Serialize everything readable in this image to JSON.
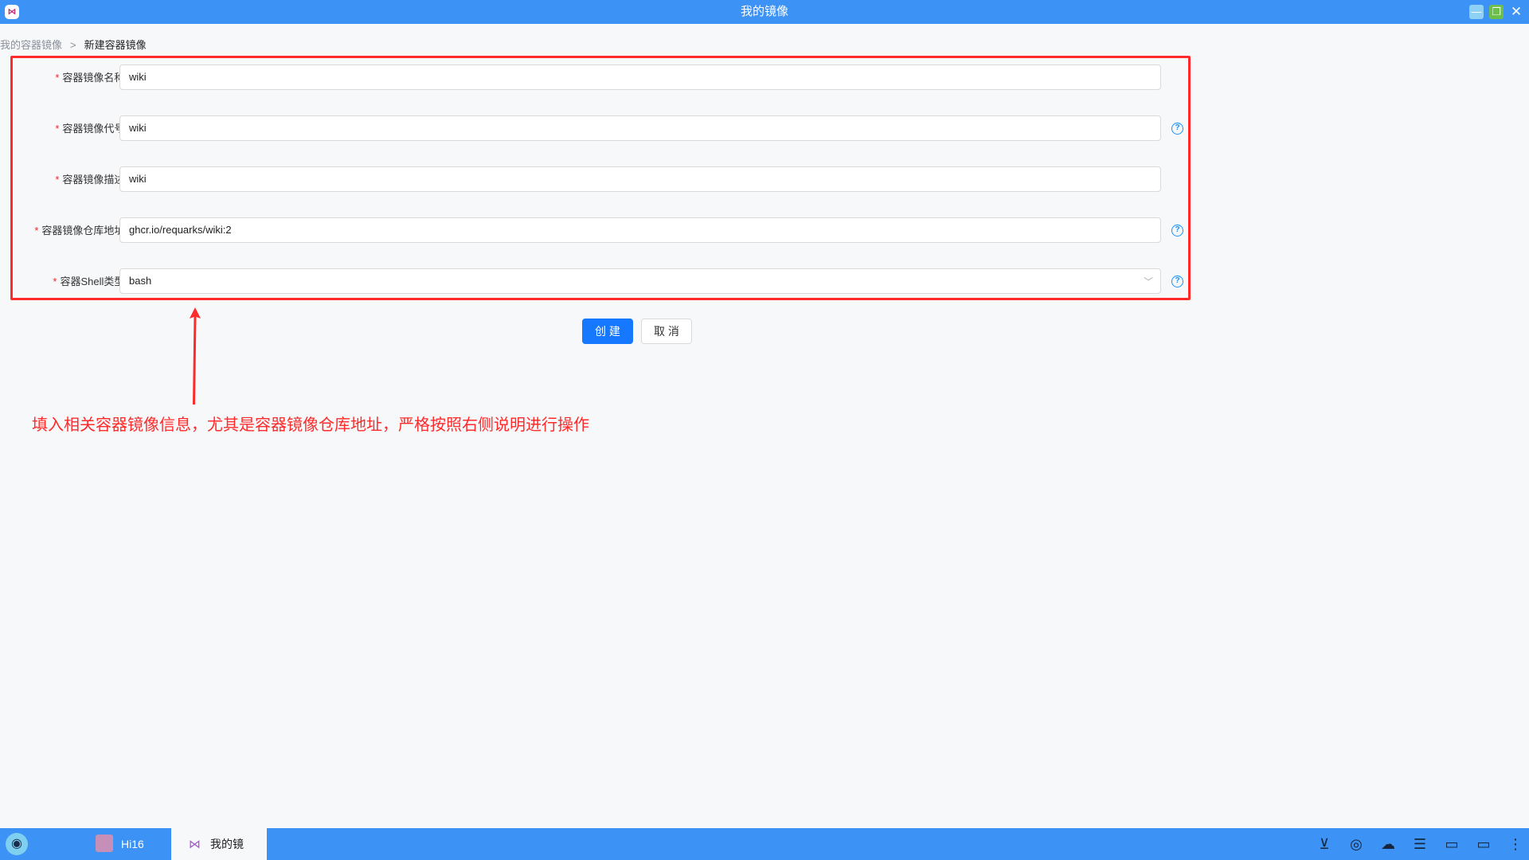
{
  "window": {
    "title": "我的镜像",
    "app_icon": "docker-mirror-icon",
    "controls": [
      "minimize-icon",
      "maximize-icon",
      "close-icon"
    ]
  },
  "breadcrumb": {
    "parent": "我的容器镜像",
    "separator": ">",
    "current": "新建容器镜像"
  },
  "form": {
    "required_mark": "*",
    "fields": [
      {
        "label": "容器镜像名称:",
        "value": "wiki",
        "has_help": false
      },
      {
        "label": "容器镜像代号:",
        "value": "wiki",
        "has_help": true
      },
      {
        "label": "容器镜像描述:",
        "value": "wiki",
        "has_help": false
      },
      {
        "label": "容器镜像仓库地址:",
        "value": "ghcr.io/requarks/wiki:2",
        "has_help": true
      },
      {
        "label": "容器Shell类型:",
        "value": "bash",
        "has_help": true,
        "type": "select"
      }
    ],
    "help_glyph": "?",
    "select_arrow": "﹀"
  },
  "actions": {
    "create_label": "创 建",
    "cancel_label": "取 消",
    "primary_color": "#1677ff"
  },
  "annotation": {
    "text": "填入相关容器镜像信息，尤其是容器镜像仓库地址，严格按照右侧说明进行操作",
    "color": "#ff2a2a"
  },
  "taskbar": {
    "items": [
      {
        "label": "Hi16",
        "active": false
      },
      {
        "label": "我的镜",
        "active": true
      }
    ],
    "tray_icons": [
      "download-icon",
      "broadcast-icon",
      "wechat-icon",
      "notes-icon",
      "chat-icon",
      "display-icon",
      "more-icon"
    ]
  },
  "colors": {
    "titlebar": "#3d93f5",
    "highlight_border": "#ff2a2a"
  }
}
